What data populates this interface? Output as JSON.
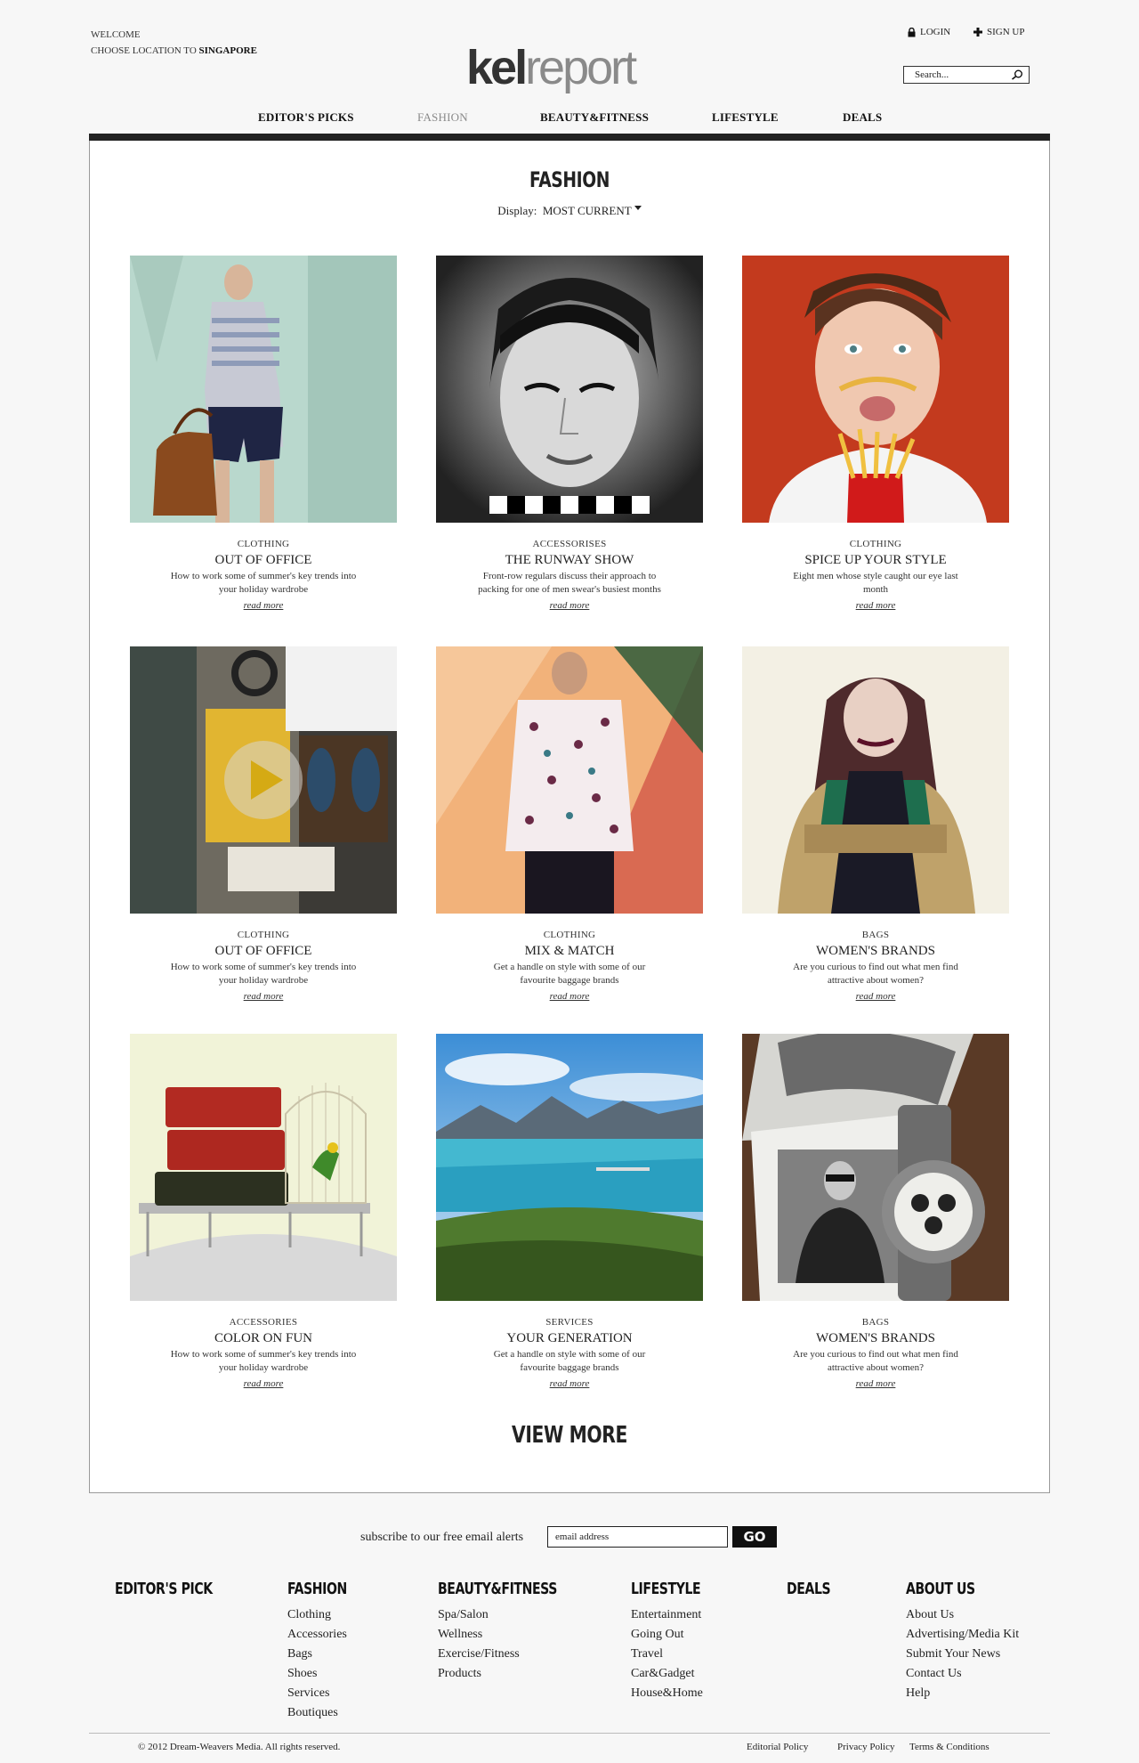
{
  "header": {
    "welcome": "WELCOME",
    "location_prefix": "CHOOSE LOCATION TO",
    "location": "SINGAPORE",
    "logo_part1": "kel",
    "logo_part2": "report",
    "login": "LOGIN",
    "signup": "SIGN UP",
    "search_placeholder": "Search..."
  },
  "nav": {
    "items": [
      {
        "label": "EDITOR'S PICKS"
      },
      {
        "label": "FASHION"
      },
      {
        "label": "BEAUTY&FITNESS"
      },
      {
        "label": "LIFESTYLE"
      },
      {
        "label": "DEALS"
      }
    ]
  },
  "main": {
    "title": "FASHION",
    "display_label": "Display:",
    "display_value": "MOST CURRENT",
    "view_more": "VIEW MORE",
    "cards": [
      {
        "category": "CLOTHING",
        "title": "OUT OF OFFICE",
        "desc": "How to work some of summer's key trends into your holiday wardrobe",
        "more": "read more"
      },
      {
        "category": "ACCESSORISES",
        "title": "THE RUNWAY SHOW",
        "desc": "Front-row regulars discuss their approach to packing for one of men swear's busiest months",
        "more": "read more"
      },
      {
        "category": "CLOTHING",
        "title": "SPICE UP YOUR STYLE",
        "desc": "Eight men whose style caught our eye last month",
        "more": "read more"
      },
      {
        "category": "CLOTHING",
        "title": "OUT OF OFFICE",
        "desc": "How to work some of summer's key trends into your holiday wardrobe",
        "more": "read more"
      },
      {
        "category": "CLOTHING",
        "title": "MIX & MATCH",
        "desc": "Get a handle on style with some of our favourite baggage brands",
        "more": "read more"
      },
      {
        "category": "BAGS",
        "title": "WOMEN'S BRANDS",
        "desc": "Are you curious to find out what men find attractive about women?",
        "more": "read more"
      },
      {
        "category": "ACCESSORIES",
        "title": "COLOR ON FUN",
        "desc": "How to work some of summer's key trends into your holiday wardrobe",
        "more": "read more"
      },
      {
        "category": "SERVICES",
        "title": "YOUR GENERATION",
        "desc": "Get a handle on style with some of our favourite baggage brands",
        "more": "read more"
      },
      {
        "category": "BAGS",
        "title": "WOMEN'S BRANDS",
        "desc": "Are you curious to find out what men find attractive about women?",
        "more": "read more"
      }
    ]
  },
  "subscribe": {
    "label": "subscribe to our free email alerts",
    "placeholder": "email address",
    "button": "GO"
  },
  "footer": {
    "columns": [
      {
        "heading": "EDITOR'S PICK",
        "links": []
      },
      {
        "heading": "FASHION",
        "links": [
          "Clothing",
          "Accessories",
          "Bags",
          "Shoes",
          "Services",
          "Boutiques"
        ]
      },
      {
        "heading": "BEAUTY&FITNESS",
        "links": [
          "Spa/Salon",
          "Wellness",
          "Exercise/Fitness",
          "Products"
        ]
      },
      {
        "heading": "LIFESTYLE",
        "links": [
          "Entertainment",
          "Going Out",
          "Travel",
          "Car&Gadget",
          "House&Home"
        ]
      },
      {
        "heading": "DEALS",
        "links": []
      },
      {
        "heading": "ABOUT US",
        "links": [
          "About Us",
          "Advertising/Media Kit",
          "Submit Your News",
          "Contact Us",
          "Help"
        ]
      }
    ],
    "copyright": "© 2012 Dream-Weavers Media. All rights reserved.",
    "editorial": "Editorial Policy",
    "privacy": "Privacy Policy",
    "terms": "Terms & Conditions"
  },
  "colors": {
    "background": "#f7f7f7",
    "nav_bar": "#222222",
    "muted_nav": "#8a8a8a",
    "logo_gray": "#8a8a8a"
  }
}
